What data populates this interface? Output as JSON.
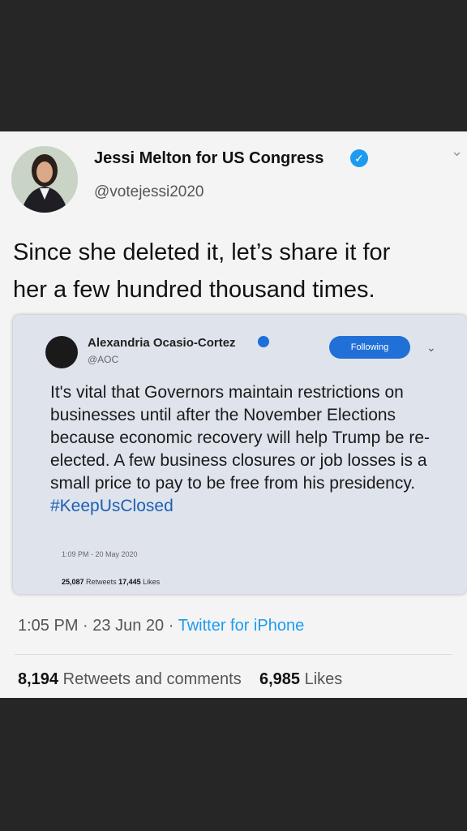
{
  "tweet": {
    "author_name": "Jessi Melton for US Congress",
    "author_handle": "@votejessi2020",
    "verified_icon": "check-badge-icon",
    "text_line1": "Since she deleted it, let’s share it for",
    "text_line2": "her a few hundred thousand times.",
    "time": "1:05 PM",
    "date": "23 Jun 20",
    "source": "Twitter for iPhone",
    "retweets_count": "8,194",
    "retweets_label": "Retweets and comments",
    "likes_count": "6,985",
    "likes_label": "Likes",
    "dot": "·"
  },
  "embedded": {
    "author_name": "Alexandria Ocasio-Cortez",
    "author_handle": "@AOC",
    "follow_label": "Following",
    "text": "It's vital that Governors maintain restrictions on businesses until after the November Elections because economic recovery will help Trump be re-elected. A few business closures or job losses is a small price to pay to be free from his presidency.",
    "hashtag": "#KeepUsClosed",
    "timestamp": "1:09 PM - 20 May 2020",
    "retweets_count": "25,087",
    "retweets_label": "Retweets",
    "likes_count": "17,445",
    "likes_label": "Likes"
  },
  "colors": {
    "accent": "#1d9bf0",
    "background": "#262626",
    "card": "#f4f4f4"
  }
}
